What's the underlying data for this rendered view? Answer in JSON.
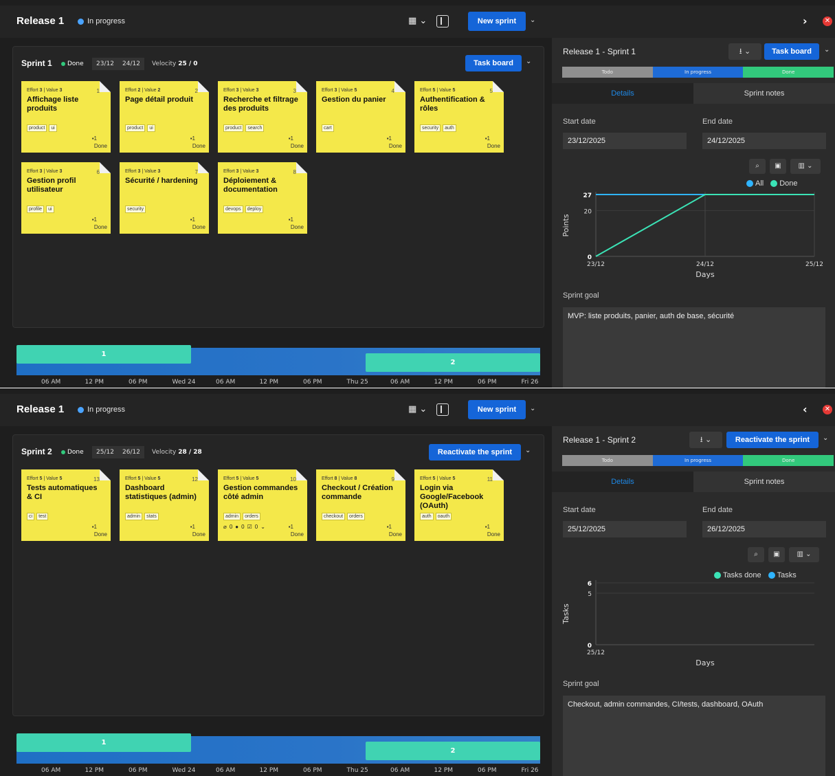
{
  "colors": {
    "accent": "#1565d8",
    "in_progress_dot": "#4aa3ff",
    "done_dot": "#32c97c",
    "card": "#f4e84a",
    "timeline_bar": "#40d3b2",
    "chart_all": "#2fb4ff",
    "chart_done": "#3be3b6"
  },
  "shot1": {
    "release": {
      "title": "Release 1",
      "status": "In progress"
    },
    "toolbar": {
      "new_sprint": "New sprint",
      "nav_icon": "chevron-right-icon",
      "nav_glyph": "›"
    },
    "sprint": {
      "name": "Sprint 1",
      "status": "Done",
      "start": "23/12",
      "end": "24/12",
      "velocity_label": "Velocity",
      "velocity_value": "25 / 0",
      "primary_button": "Task board"
    },
    "cards": [
      {
        "num": "1",
        "effort": "3",
        "value": "3",
        "title": "Affichage liste produits",
        "tags": [
          "product",
          "ui"
        ],
        "count": "1",
        "state": "Done"
      },
      {
        "num": "2",
        "effort": "2",
        "value": "2",
        "title": "Page détail produit",
        "tags": [
          "product",
          "ui"
        ],
        "count": "1",
        "state": "Done"
      },
      {
        "num": "3",
        "effort": "3",
        "value": "3",
        "title": "Recherche et filtrage des produits",
        "tags": [
          "product",
          "search"
        ],
        "count": "1",
        "state": "Done"
      },
      {
        "num": "4",
        "effort": "3",
        "value": "5",
        "title": "Gestion du panier",
        "tags": [
          "cart"
        ],
        "count": "1",
        "state": "Done"
      },
      {
        "num": "5",
        "effort": "5",
        "value": "5",
        "title": "Authentification & rôles",
        "tags": [
          "security",
          "auth"
        ],
        "count": "1",
        "state": "Done"
      },
      {
        "num": "6",
        "effort": "3",
        "value": "3",
        "title": "Gestion profil utilisateur",
        "tags": [
          "profile",
          "ui"
        ],
        "count": "1",
        "state": "Done"
      },
      {
        "num": "7",
        "effort": "3",
        "value": "3",
        "title": "Sécurité / hardening",
        "tags": [
          "security"
        ],
        "count": "1",
        "state": "Done"
      },
      {
        "num": "8",
        "effort": "3",
        "value": "3",
        "title": "Déploiement & documentation",
        "tags": [
          "devops",
          "deploy"
        ],
        "count": "1",
        "state": "Done"
      }
    ],
    "panel": {
      "title": "Release 1 - Sprint 1",
      "primary_button": "Task board",
      "progress": [
        "Todo",
        "In progress",
        "Done"
      ],
      "tab_details": "Details",
      "tab_notes": "Sprint notes",
      "start_label": "Start date",
      "end_label": "End date",
      "start_value": "23/12/2025",
      "end_value": "24/12/2025",
      "goal_label": "Sprint goal",
      "goal_value": "MVP: liste produits, panier, auth de base, sécurité"
    },
    "chart_data": {
      "type": "line",
      "xlabel": "Days",
      "ylabel": "Points",
      "x": [
        "23/12",
        "24/12",
        "25/12"
      ],
      "yticks": [
        0,
        20,
        27
      ],
      "ylim": [
        0,
        27
      ],
      "series": [
        {
          "name": "All",
          "values": [
            27,
            27,
            27
          ]
        },
        {
          "name": "Done",
          "values": [
            0,
            27,
            27
          ]
        }
      ],
      "legend": "top-right",
      "grid": true
    }
  },
  "shot2": {
    "release": {
      "title": "Release 1",
      "status": "In progress"
    },
    "toolbar": {
      "new_sprint": "New sprint",
      "nav_icon": "chevron-left-icon",
      "nav_glyph": "‹"
    },
    "sprint": {
      "name": "Sprint 2",
      "status": "Done",
      "start": "25/12",
      "end": "26/12",
      "velocity_label": "Velocity",
      "velocity_value": "28 / 28",
      "primary_button": "Reactivate the sprint"
    },
    "cards": [
      {
        "num": "13",
        "effort": "5",
        "value": "5",
        "title": "Tests automatiques & CI",
        "tags": [
          "ci",
          "test"
        ],
        "count": "1",
        "state": "Done"
      },
      {
        "num": "12",
        "effort": "5",
        "value": "5",
        "title": "Dashboard statistiques (admin)",
        "tags": [
          "admin",
          "stats"
        ],
        "count": "1",
        "state": "Done"
      },
      {
        "num": "10",
        "effort": "5",
        "value": "5",
        "title": "Gestion commandes côté admin",
        "tags": [
          "admin",
          "orders"
        ],
        "count": "1",
        "state": "Done",
        "attach": "0",
        "comments": "0",
        "checks": "0"
      },
      {
        "num": "9",
        "effort": "8",
        "value": "8",
        "title": "Checkout / Création commande",
        "tags": [
          "checkout",
          "orders"
        ],
        "count": "1",
        "state": "Done"
      },
      {
        "num": "11",
        "effort": "5",
        "value": "5",
        "title": "Login via Google/Facebook (OAuth)",
        "tags": [
          "auth",
          "oauth"
        ],
        "count": "1",
        "state": "Done"
      }
    ],
    "panel": {
      "title": "Release 1 - Sprint 2",
      "primary_button": "Reactivate the sprint",
      "progress": [
        "Todo",
        "In progress",
        "Done"
      ],
      "tab_details": "Details",
      "tab_notes": "Sprint notes",
      "start_label": "Start date",
      "end_label": "End date",
      "start_value": "25/12/2025",
      "end_value": "26/12/2025",
      "goal_label": "Sprint goal",
      "goal_value": "Checkout, admin commandes, CI/tests, dashboard, OAuth"
    },
    "chart_data": {
      "type": "line",
      "xlabel": "Days",
      "ylabel": "Tasks",
      "x": [
        "25/12"
      ],
      "yticks": [
        0,
        5,
        6
      ],
      "ylim": [
        0,
        6
      ],
      "series": [
        {
          "name": "Tasks done",
          "values": []
        },
        {
          "name": "Tasks",
          "values": []
        }
      ],
      "legend": "top-right",
      "grid": true
    }
  },
  "timeline": {
    "bars": [
      "1",
      "2"
    ],
    "ticks": [
      "06 AM",
      "12 PM",
      "06 PM",
      "Wed 24",
      "06 AM",
      "12 PM",
      "06 PM",
      "Thu 25",
      "06 AM",
      "12 PM",
      "06 PM",
      "Fri 26"
    ]
  }
}
